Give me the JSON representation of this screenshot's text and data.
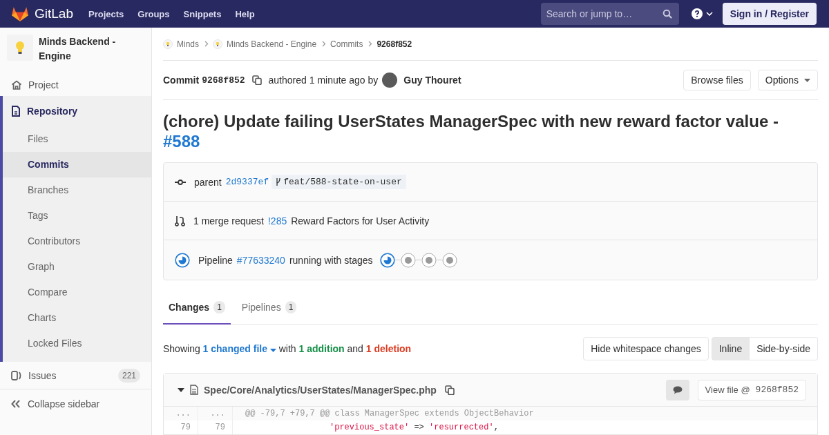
{
  "navbar": {
    "logo_text": "GitLab",
    "links": [
      "Projects",
      "Groups",
      "Snippets",
      "Help"
    ],
    "search": {
      "placeholder": "Search or jump to…"
    },
    "sign_in": "Sign in / Register"
  },
  "sidebar": {
    "project_name": "Minds Backend - Engine",
    "items": [
      {
        "label": "Project",
        "kind": "home",
        "selected": false
      },
      {
        "label": "Repository",
        "kind": "repo",
        "selected": true,
        "children": [
          {
            "label": "Files",
            "selected": false
          },
          {
            "label": "Commits",
            "selected": true
          },
          {
            "label": "Branches",
            "selected": false
          },
          {
            "label": "Tags",
            "selected": false
          },
          {
            "label": "Contributors",
            "selected": false
          },
          {
            "label": "Graph",
            "selected": false
          },
          {
            "label": "Compare",
            "selected": false
          },
          {
            "label": "Charts",
            "selected": false
          },
          {
            "label": "Locked Files",
            "selected": false
          }
        ]
      },
      {
        "label": "Issues",
        "kind": "issues",
        "selected": false,
        "badge": "221"
      }
    ],
    "collapse": "Collapse sidebar"
  },
  "breadcrumbs": [
    {
      "label": "Minds",
      "kind": "group"
    },
    {
      "label": "Minds Backend - Engine",
      "kind": "group"
    },
    {
      "label": "Commits",
      "kind": "link"
    },
    {
      "label": "9268f852",
      "kind": "current"
    }
  ],
  "commit": {
    "label": "Commit",
    "sha": "9268f852",
    "authored": "authored 1 minute ago by",
    "author": "Guy Thouret",
    "buttons": [
      {
        "label": "Browse files",
        "kind": "plain"
      },
      {
        "label": "Options",
        "kind": "dropdown"
      }
    ]
  },
  "title": {
    "text": "(chore) Update failing UserStates ManagerSpec with new reward factor value -",
    "link": "#588"
  },
  "info": {
    "parent": {
      "label": "parent",
      "sha": "2d9337ef",
      "branch": "feat/588-state-on-user"
    },
    "merge": {
      "text": "1 merge request",
      "link": "!285",
      "title": "Reward Factors for User Activity"
    },
    "pipeline": {
      "label": "Pipeline",
      "link": "#77633240",
      "text": "running with stages",
      "stages": [
        {
          "kind": "running"
        },
        {
          "kind": "pending"
        },
        {
          "kind": "pending"
        },
        {
          "kind": "pending"
        }
      ]
    }
  },
  "tabs": [
    {
      "label": "Changes",
      "count": "1",
      "selected": true
    },
    {
      "label": "Pipelines",
      "count": "1",
      "selected": false
    }
  ],
  "summary": {
    "showing": "Showing",
    "files": "1 changed file",
    "with": "with",
    "additions": "1 addition",
    "and": "and",
    "deletions": "1 deletion"
  },
  "whitespace_button": "Hide whitespace changes",
  "view_modes": [
    {
      "label": "Inline",
      "selected": true
    },
    {
      "label": "Side-by-side",
      "selected": false
    }
  ],
  "file": {
    "path": "Spec/Core/Analytics/UserStates/ManagerSpec.php",
    "view_label": "View file @",
    "view_sha": "9268f852",
    "lines": [
      {
        "kind": "match",
        "old": "...",
        "new": "...",
        "tokens": [
          {
            "kind": "plain",
            "text": "@@ -79,7 +79,7 @@ class ManagerSpec extends ObjectBehavior"
          }
        ]
      },
      {
        "kind": "context",
        "old": "79",
        "new": "79",
        "tokens": [
          {
            "kind": "string",
            "text": "'previous_state'"
          },
          {
            "kind": "plain",
            "text": " => "
          },
          {
            "kind": "string",
            "text": "'resurrected'"
          },
          {
            "kind": "plain",
            "text": ","
          }
        ]
      }
    ]
  }
}
